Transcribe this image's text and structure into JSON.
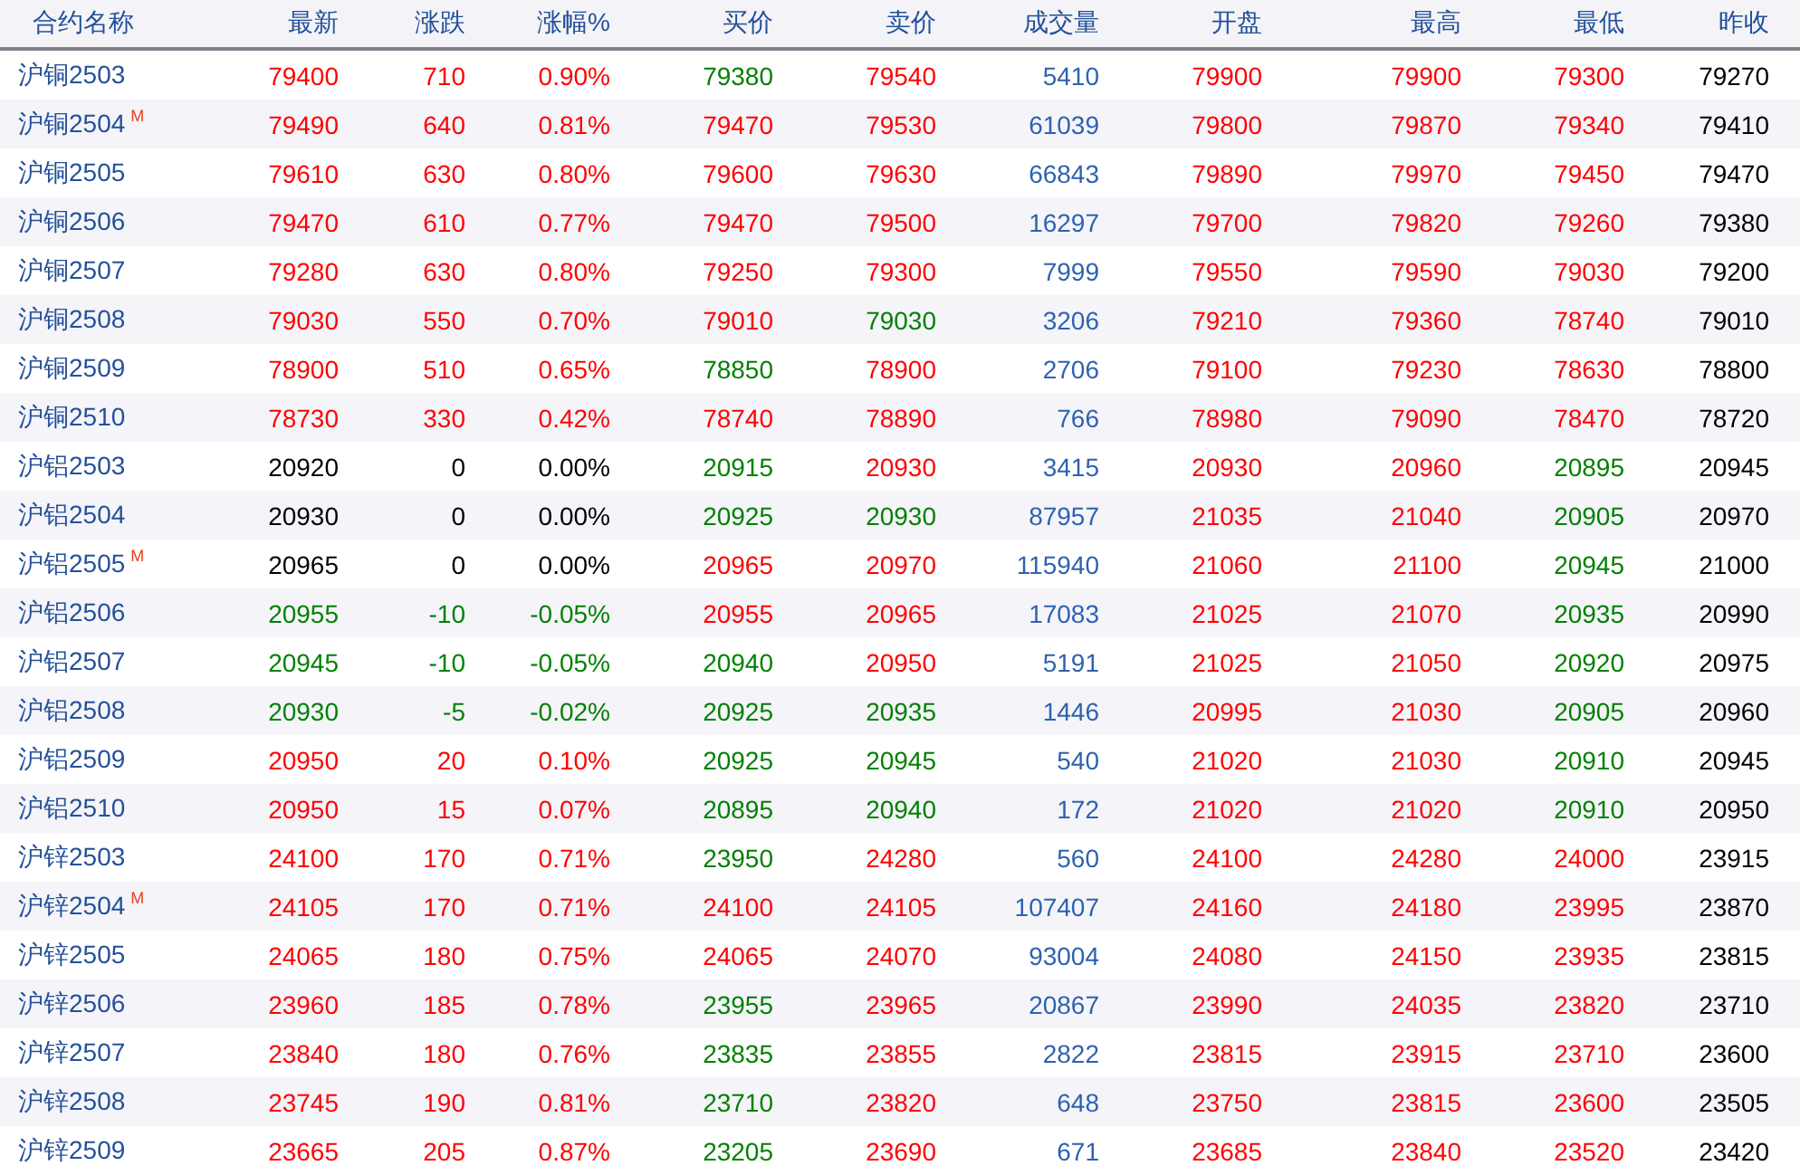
{
  "table": {
    "name_column": "合约名称",
    "columns": [
      "最新",
      "涨跌",
      "涨幅%",
      "买价",
      "卖价",
      "成交量",
      "开盘",
      "最高",
      "最低",
      "昨收"
    ],
    "rows": [
      {
        "contract": "沪铜2503",
        "cells": [
          {
            "text": "79400",
            "color": "#ff0000"
          },
          {
            "text": "710",
            "color": "#ff0000"
          },
          {
            "text": "0.90%",
            "color": "#ff0000"
          },
          {
            "text": "79380",
            "color": "#008000"
          },
          {
            "text": "79540",
            "color": "#ff0000"
          },
          {
            "text": "5410"
          },
          {
            "text": "79900",
            "color": "#ff0000"
          },
          {
            "text": "79900",
            "color": "#ff0000"
          },
          {
            "text": "79300",
            "color": "#ff0000"
          },
          {
            "text": "79270"
          }
        ]
      },
      {
        "contract": "沪铜2504",
        "badge": "M",
        "cells": [
          {
            "text": "79490",
            "color": "#ff0000"
          },
          {
            "text": "640",
            "color": "#ff0000"
          },
          {
            "text": "0.81%",
            "color": "#ff0000"
          },
          {
            "text": "79470",
            "color": "#ff0000"
          },
          {
            "text": "79530",
            "color": "#ff0000"
          },
          {
            "text": "61039"
          },
          {
            "text": "79800",
            "color": "#ff0000"
          },
          {
            "text": "79870",
            "color": "#ff0000"
          },
          {
            "text": "79340",
            "color": "#ff0000"
          },
          {
            "text": "79410"
          }
        ]
      },
      {
        "contract": "沪铜2505",
        "cells": [
          {
            "text": "79610",
            "color": "#ff0000"
          },
          {
            "text": "630",
            "color": "#ff0000"
          },
          {
            "text": "0.80%",
            "color": "#ff0000"
          },
          {
            "text": "79600",
            "color": "#ff0000"
          },
          {
            "text": "79630",
            "color": "#ff0000"
          },
          {
            "text": "66843"
          },
          {
            "text": "79890",
            "color": "#ff0000"
          },
          {
            "text": "79970",
            "color": "#ff0000"
          },
          {
            "text": "79450",
            "color": "#ff0000"
          },
          {
            "text": "79470"
          }
        ]
      },
      {
        "contract": "沪铜2506",
        "cells": [
          {
            "text": "79470",
            "color": "#ff0000"
          },
          {
            "text": "610",
            "color": "#ff0000"
          },
          {
            "text": "0.77%",
            "color": "#ff0000"
          },
          {
            "text": "79470",
            "color": "#ff0000"
          },
          {
            "text": "79500",
            "color": "#ff0000"
          },
          {
            "text": "16297"
          },
          {
            "text": "79700",
            "color": "#ff0000"
          },
          {
            "text": "79820",
            "color": "#ff0000"
          },
          {
            "text": "79260",
            "color": "#ff0000"
          },
          {
            "text": "79380"
          }
        ]
      },
      {
        "contract": "沪铜2507",
        "cells": [
          {
            "text": "79280",
            "color": "#ff0000"
          },
          {
            "text": "630",
            "color": "#ff0000"
          },
          {
            "text": "0.80%",
            "color": "#ff0000"
          },
          {
            "text": "79250",
            "color": "#ff0000"
          },
          {
            "text": "79300",
            "color": "#ff0000"
          },
          {
            "text": "7999"
          },
          {
            "text": "79550",
            "color": "#ff0000"
          },
          {
            "text": "79590",
            "color": "#ff0000"
          },
          {
            "text": "79030",
            "color": "#ff0000"
          },
          {
            "text": "79200"
          }
        ]
      },
      {
        "contract": "沪铜2508",
        "cells": [
          {
            "text": "79030",
            "color": "#ff0000"
          },
          {
            "text": "550",
            "color": "#ff0000"
          },
          {
            "text": "0.70%",
            "color": "#ff0000"
          },
          {
            "text": "79010",
            "color": "#ff0000"
          },
          {
            "text": "79030",
            "color": "#008000"
          },
          {
            "text": "3206"
          },
          {
            "text": "79210",
            "color": "#ff0000"
          },
          {
            "text": "79360",
            "color": "#ff0000"
          },
          {
            "text": "78740",
            "color": "#ff0000"
          },
          {
            "text": "79010"
          }
        ]
      },
      {
        "contract": "沪铜2509",
        "cells": [
          {
            "text": "78900",
            "color": "#ff0000"
          },
          {
            "text": "510",
            "color": "#ff0000"
          },
          {
            "text": "0.65%",
            "color": "#ff0000"
          },
          {
            "text": "78850",
            "color": "#008000"
          },
          {
            "text": "78900",
            "color": "#ff0000"
          },
          {
            "text": "2706"
          },
          {
            "text": "79100",
            "color": "#ff0000"
          },
          {
            "text": "79230",
            "color": "#ff0000"
          },
          {
            "text": "78630",
            "color": "#ff0000"
          },
          {
            "text": "78800"
          }
        ]
      },
      {
        "contract": "沪铜2510",
        "cells": [
          {
            "text": "78730",
            "color": "#ff0000"
          },
          {
            "text": "330",
            "color": "#ff0000"
          },
          {
            "text": "0.42%",
            "color": "#ff0000"
          },
          {
            "text": "78740",
            "color": "#ff0000"
          },
          {
            "text": "78890",
            "color": "#ff0000"
          },
          {
            "text": "766"
          },
          {
            "text": "78980",
            "color": "#ff0000"
          },
          {
            "text": "79090",
            "color": "#ff0000"
          },
          {
            "text": "78470",
            "color": "#ff0000"
          },
          {
            "text": "78720"
          }
        ]
      },
      {
        "contract": "沪铝2503",
        "cells": [
          {
            "text": "20920",
            "color": "#000000"
          },
          {
            "text": "0",
            "color": "#000000"
          },
          {
            "text": "0.00%",
            "color": "#000000"
          },
          {
            "text": "20915",
            "color": "#008000"
          },
          {
            "text": "20930",
            "color": "#ff0000"
          },
          {
            "text": "3415"
          },
          {
            "text": "20930",
            "color": "#ff0000"
          },
          {
            "text": "20960",
            "color": "#ff0000"
          },
          {
            "text": "20895",
            "color": "#008000"
          },
          {
            "text": "20945"
          }
        ]
      },
      {
        "contract": "沪铝2504",
        "cells": [
          {
            "text": "20930",
            "color": "#000000"
          },
          {
            "text": "0",
            "color": "#000000"
          },
          {
            "text": "0.00%",
            "color": "#000000"
          },
          {
            "text": "20925",
            "color": "#008000"
          },
          {
            "text": "20930",
            "color": "#008000"
          },
          {
            "text": "87957"
          },
          {
            "text": "21035",
            "color": "#ff0000"
          },
          {
            "text": "21040",
            "color": "#ff0000"
          },
          {
            "text": "20905",
            "color": "#008000"
          },
          {
            "text": "20970"
          }
        ]
      },
      {
        "contract": "沪铝2505",
        "badge": "M",
        "cells": [
          {
            "text": "20965",
            "color": "#000000"
          },
          {
            "text": "0",
            "color": "#000000"
          },
          {
            "text": "0.00%",
            "color": "#000000"
          },
          {
            "text": "20965",
            "color": "#ff0000"
          },
          {
            "text": "20970",
            "color": "#ff0000"
          },
          {
            "text": "115940"
          },
          {
            "text": "21060",
            "color": "#ff0000"
          },
          {
            "text": "21100",
            "color": "#ff0000"
          },
          {
            "text": "20945",
            "color": "#008000"
          },
          {
            "text": "21000"
          }
        ]
      },
      {
        "contract": "沪铝2506",
        "cells": [
          {
            "text": "20955",
            "color": "#008000"
          },
          {
            "text": "-10",
            "color": "#008000"
          },
          {
            "text": "-0.05%",
            "color": "#008000"
          },
          {
            "text": "20955",
            "color": "#ff0000"
          },
          {
            "text": "20965",
            "color": "#ff0000"
          },
          {
            "text": "17083"
          },
          {
            "text": "21025",
            "color": "#ff0000"
          },
          {
            "text": "21070",
            "color": "#ff0000"
          },
          {
            "text": "20935",
            "color": "#008000"
          },
          {
            "text": "20990"
          }
        ]
      },
      {
        "contract": "沪铝2507",
        "cells": [
          {
            "text": "20945",
            "color": "#008000"
          },
          {
            "text": "-10",
            "color": "#008000"
          },
          {
            "text": "-0.05%",
            "color": "#008000"
          },
          {
            "text": "20940",
            "color": "#008000"
          },
          {
            "text": "20950",
            "color": "#ff0000"
          },
          {
            "text": "5191"
          },
          {
            "text": "21025",
            "color": "#ff0000"
          },
          {
            "text": "21050",
            "color": "#ff0000"
          },
          {
            "text": "20920",
            "color": "#008000"
          },
          {
            "text": "20975"
          }
        ]
      },
      {
        "contract": "沪铝2508",
        "cells": [
          {
            "text": "20930",
            "color": "#008000"
          },
          {
            "text": "-5",
            "color": "#008000"
          },
          {
            "text": "-0.02%",
            "color": "#008000"
          },
          {
            "text": "20925",
            "color": "#008000"
          },
          {
            "text": "20935",
            "color": "#008000"
          },
          {
            "text": "1446"
          },
          {
            "text": "20995",
            "color": "#ff0000"
          },
          {
            "text": "21030",
            "color": "#ff0000"
          },
          {
            "text": "20905",
            "color": "#008000"
          },
          {
            "text": "20960"
          }
        ]
      },
      {
        "contract": "沪铝2509",
        "cells": [
          {
            "text": "20950",
            "color": "#ff0000"
          },
          {
            "text": "20",
            "color": "#ff0000"
          },
          {
            "text": "0.10%",
            "color": "#ff0000"
          },
          {
            "text": "20925",
            "color": "#008000"
          },
          {
            "text": "20945",
            "color": "#008000"
          },
          {
            "text": "540"
          },
          {
            "text": "21020",
            "color": "#ff0000"
          },
          {
            "text": "21030",
            "color": "#ff0000"
          },
          {
            "text": "20910",
            "color": "#008000"
          },
          {
            "text": "20945"
          }
        ]
      },
      {
        "contract": "沪铝2510",
        "cells": [
          {
            "text": "20950",
            "color": "#ff0000"
          },
          {
            "text": "15",
            "color": "#ff0000"
          },
          {
            "text": "0.07%",
            "color": "#ff0000"
          },
          {
            "text": "20895",
            "color": "#008000"
          },
          {
            "text": "20940",
            "color": "#008000"
          },
          {
            "text": "172"
          },
          {
            "text": "21020",
            "color": "#ff0000"
          },
          {
            "text": "21020",
            "color": "#ff0000"
          },
          {
            "text": "20910",
            "color": "#008000"
          },
          {
            "text": "20950"
          }
        ]
      },
      {
        "contract": "沪锌2503",
        "cells": [
          {
            "text": "24100",
            "color": "#ff0000"
          },
          {
            "text": "170",
            "color": "#ff0000"
          },
          {
            "text": "0.71%",
            "color": "#ff0000"
          },
          {
            "text": "23950",
            "color": "#008000"
          },
          {
            "text": "24280",
            "color": "#ff0000"
          },
          {
            "text": "560"
          },
          {
            "text": "24100",
            "color": "#ff0000"
          },
          {
            "text": "24280",
            "color": "#ff0000"
          },
          {
            "text": "24000",
            "color": "#ff0000"
          },
          {
            "text": "23915"
          }
        ]
      },
      {
        "contract": "沪锌2504",
        "badge": "M",
        "cells": [
          {
            "text": "24105",
            "color": "#ff0000"
          },
          {
            "text": "170",
            "color": "#ff0000"
          },
          {
            "text": "0.71%",
            "color": "#ff0000"
          },
          {
            "text": "24100",
            "color": "#ff0000"
          },
          {
            "text": "24105",
            "color": "#ff0000"
          },
          {
            "text": "107407"
          },
          {
            "text": "24160",
            "color": "#ff0000"
          },
          {
            "text": "24180",
            "color": "#ff0000"
          },
          {
            "text": "23995",
            "color": "#ff0000"
          },
          {
            "text": "23870"
          }
        ]
      },
      {
        "contract": "沪锌2505",
        "cells": [
          {
            "text": "24065",
            "color": "#ff0000"
          },
          {
            "text": "180",
            "color": "#ff0000"
          },
          {
            "text": "0.75%",
            "color": "#ff0000"
          },
          {
            "text": "24065",
            "color": "#ff0000"
          },
          {
            "text": "24070",
            "color": "#ff0000"
          },
          {
            "text": "93004"
          },
          {
            "text": "24080",
            "color": "#ff0000"
          },
          {
            "text": "24150",
            "color": "#ff0000"
          },
          {
            "text": "23935",
            "color": "#ff0000"
          },
          {
            "text": "23815"
          }
        ]
      },
      {
        "contract": "沪锌2506",
        "cells": [
          {
            "text": "23960",
            "color": "#ff0000"
          },
          {
            "text": "185",
            "color": "#ff0000"
          },
          {
            "text": "0.78%",
            "color": "#ff0000"
          },
          {
            "text": "23955",
            "color": "#008000"
          },
          {
            "text": "23965",
            "color": "#ff0000"
          },
          {
            "text": "20867"
          },
          {
            "text": "23990",
            "color": "#ff0000"
          },
          {
            "text": "24035",
            "color": "#ff0000"
          },
          {
            "text": "23820",
            "color": "#ff0000"
          },
          {
            "text": "23710"
          }
        ]
      },
      {
        "contract": "沪锌2507",
        "cells": [
          {
            "text": "23840",
            "color": "#ff0000"
          },
          {
            "text": "180",
            "color": "#ff0000"
          },
          {
            "text": "0.76%",
            "color": "#ff0000"
          },
          {
            "text": "23835",
            "color": "#008000"
          },
          {
            "text": "23855",
            "color": "#ff0000"
          },
          {
            "text": "2822"
          },
          {
            "text": "23815",
            "color": "#ff0000"
          },
          {
            "text": "23915",
            "color": "#ff0000"
          },
          {
            "text": "23710",
            "color": "#ff0000"
          },
          {
            "text": "23600"
          }
        ]
      },
      {
        "contract": "沪锌2508",
        "cells": [
          {
            "text": "23745",
            "color": "#ff0000"
          },
          {
            "text": "190",
            "color": "#ff0000"
          },
          {
            "text": "0.81%",
            "color": "#ff0000"
          },
          {
            "text": "23710",
            "color": "#008000"
          },
          {
            "text": "23820",
            "color": "#ff0000"
          },
          {
            "text": "648"
          },
          {
            "text": "23750",
            "color": "#ff0000"
          },
          {
            "text": "23815",
            "color": "#ff0000"
          },
          {
            "text": "23600",
            "color": "#ff0000"
          },
          {
            "text": "23505"
          }
        ]
      },
      {
        "contract": "沪锌2509",
        "cells": [
          {
            "text": "23665",
            "color": "#ff0000"
          },
          {
            "text": "205",
            "color": "#ff0000"
          },
          {
            "text": "0.87%",
            "color": "#ff0000"
          },
          {
            "text": "23205",
            "color": "#008000"
          },
          {
            "text": "23690",
            "color": "#ff0000"
          },
          {
            "text": "671"
          },
          {
            "text": "23685",
            "color": "#ff0000"
          },
          {
            "text": "23840",
            "color": "#ff0000"
          },
          {
            "text": "23520",
            "color": "#ff0000"
          },
          {
            "text": "23420"
          }
        ]
      }
    ]
  }
}
